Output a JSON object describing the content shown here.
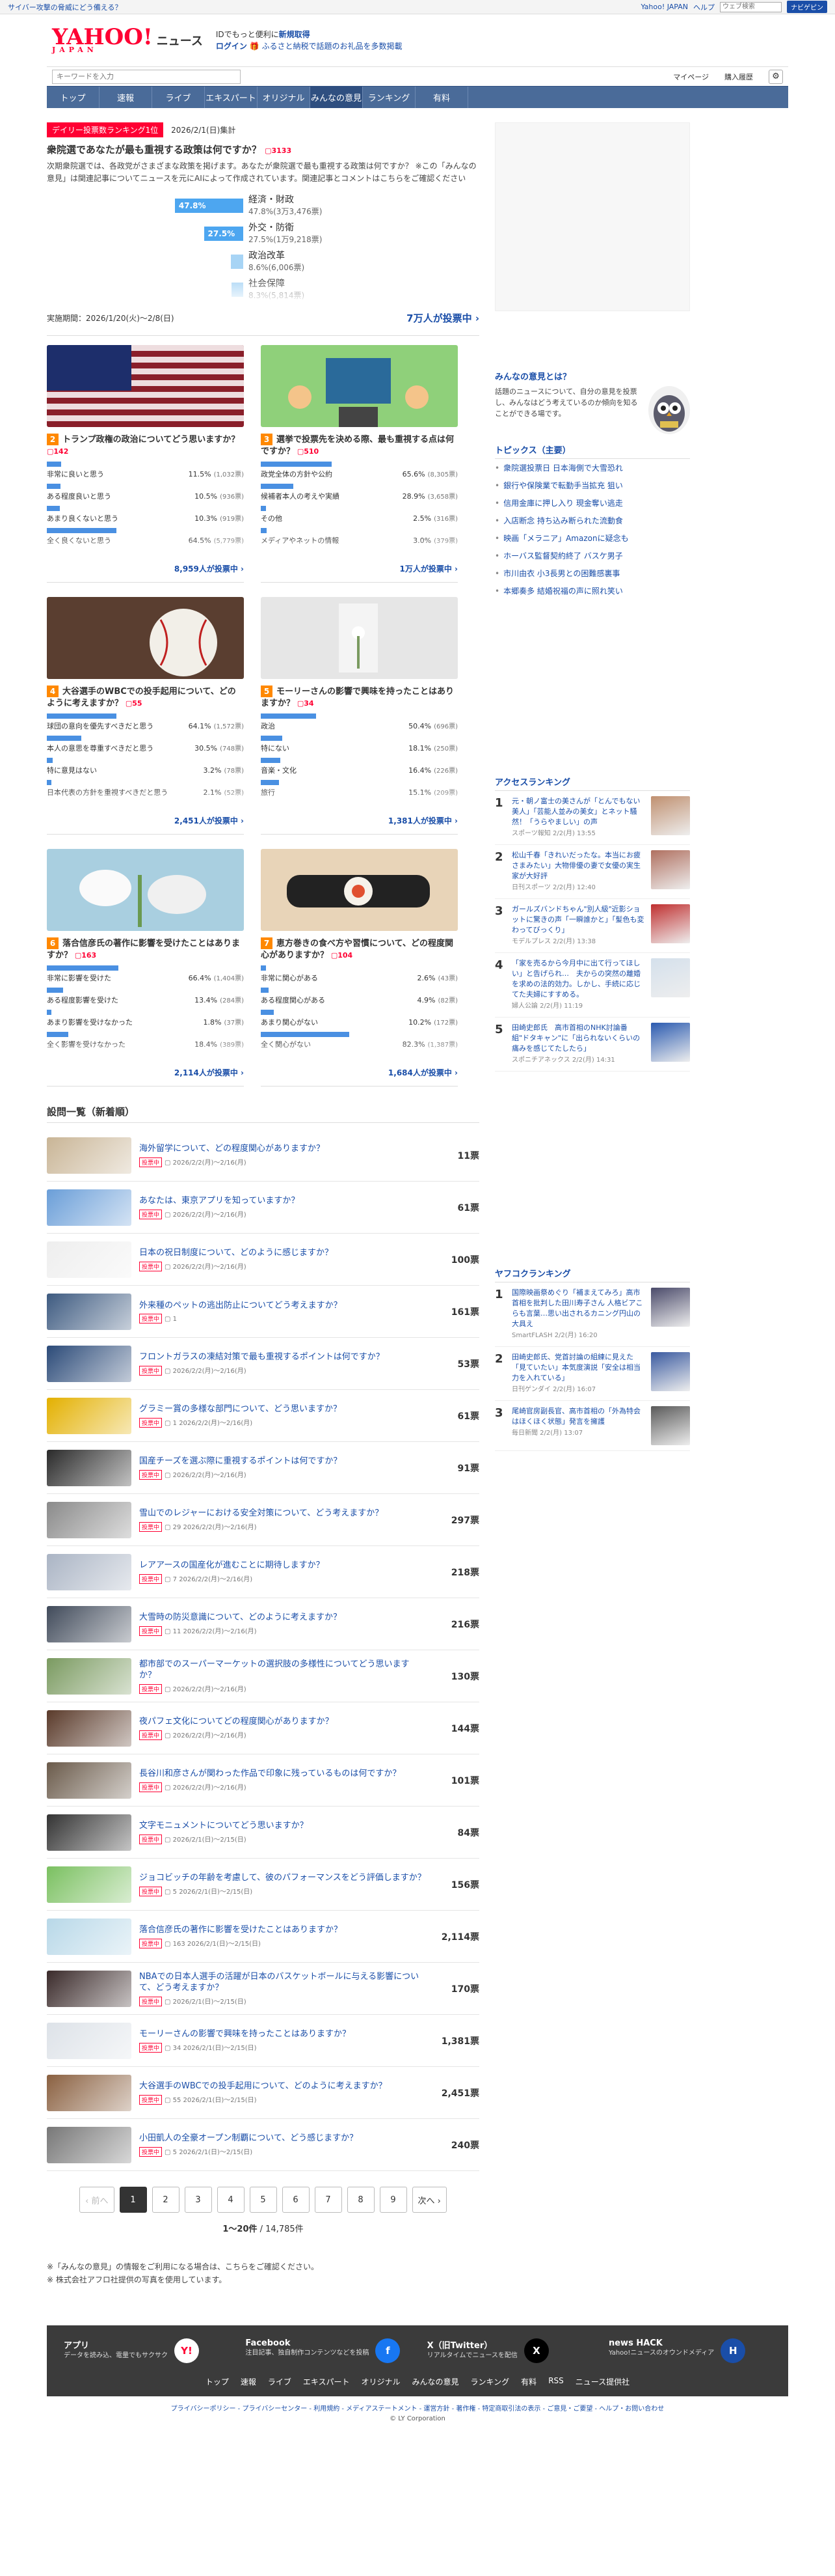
{
  "topbar": {
    "warning": "サイバー攻撃の脅威にどう備える？",
    "yahoo_japan": "Yahoo! JAPAN",
    "help": "ヘルプ",
    "search_placeholder": "ウェブ検索",
    "search_button": "ナビゲピン"
  },
  "header": {
    "logo_main": "YAHOO!",
    "logo_sub": "JAPAN",
    "logo_news": "ニュース",
    "promo1": "IDでもっと便利に",
    "promo1b": "新規取得",
    "promo2": "ログイン",
    "promo3": "ふるさと納税で話題のお礼品を多数掲載"
  },
  "subheader": {
    "keyword_placeholder": "キーワードを入力",
    "mypage": "マイページ",
    "history": "購入履歴"
  },
  "nav": [
    "トップ",
    "速報",
    "ライブ",
    "エキスパート",
    "オリジナル",
    "みんなの意見",
    "ランキング",
    "有料"
  ],
  "featured": {
    "rank_label": "デイリー投票数ランキング1位",
    "date": "2026/2/1(日)集計",
    "question": "衆院選であなたが最も重視する政策は何ですか？",
    "count": "3133",
    "description": "次期衆院選では、各政党がさまざまな政策を掲げます。あなたが衆院選で最も重視する政策は何ですか？ ※この「みんなの意見」は関連記事についてニュースを元にAIによって作成されています。関連記事とコメントはこちらをご確認ください",
    "options": [
      {
        "label": "経済・財政",
        "pct": "47.8%",
        "votes": "(3万3,476票)",
        "share": 47.8,
        "bar": "47.8%"
      },
      {
        "label": "外交・防衛",
        "pct": "27.5%",
        "votes": "(1万9,218票)",
        "share": 27.5,
        "bar": "27.5%"
      },
      {
        "label": "政治改革",
        "pct": "8.6%",
        "votes": "(6,006票)",
        "share": 8.6,
        "bar": ""
      },
      {
        "label": "社会保障",
        "pct": "8.3%",
        "votes": "(5,814票)",
        "share": 8.3,
        "bar": ""
      }
    ],
    "period": "実施期間：2026/1/20(火)〜2/8(日)",
    "total": "7万人が投票中 ›"
  },
  "cards": [
    {
      "num": "2",
      "title": "トランプ政権の政治についてどう思いますか？",
      "count": "142",
      "thumb": "flag",
      "total": "8,959人が投票中 ›",
      "options": [
        {
          "label": "非常に良いと思う",
          "pct": "11.5%",
          "votes": "(1,032票)",
          "share": 11.5
        },
        {
          "label": "ある程度良いと思う",
          "pct": "10.5%",
          "votes": "(936票)",
          "share": 10.5
        },
        {
          "label": "あまり良くないと思う",
          "pct": "10.3%",
          "votes": "(919票)",
          "share": 10.3
        },
        {
          "label": "全く良くないと思う",
          "pct": "64.5%",
          "votes": "(5,779票)",
          "share": 64.5
        }
      ]
    },
    {
      "num": "3",
      "title": "選挙で投票先を決める際、最も重視する点は何ですか？",
      "count": "510",
      "thumb": "people",
      "total": "1万人が投票中 ›",
      "options": [
        {
          "label": "政党全体の方針や公約",
          "pct": "65.6%",
          "votes": "(8,305票)",
          "share": 65.6
        },
        {
          "label": "候補者本人の考えや実績",
          "pct": "28.9%",
          "votes": "(3,658票)",
          "share": 28.9
        },
        {
          "label": "その他",
          "pct": "2.5%",
          "votes": "(316票)",
          "share": 2.5
        },
        {
          "label": "メディアやネットの情報",
          "pct": "3.0%",
          "votes": "(379票)",
          "share": 3.0
        }
      ]
    },
    {
      "num": "4",
      "title": "大谷選手のWBCでの投手起用について、どのように考えますか？",
      "count": "55",
      "thumb": "ball",
      "total": "2,451人が投票中 ›",
      "options": [
        {
          "label": "球団の意向を優先すべきだと思う",
          "pct": "64.1%",
          "votes": "(1,572票)",
          "share": 64.1
        },
        {
          "label": "本人の意思を尊重すべきだと思う",
          "pct": "30.5%",
          "votes": "(748票)",
          "share": 30.5
        },
        {
          "label": "特に意見はない",
          "pct": "3.2%",
          "votes": "(78票)",
          "share": 3.2
        },
        {
          "label": "日本代表の方針を重視すべきだと思う",
          "pct": "2.1%",
          "votes": "(52票)",
          "share": 2.1
        }
      ]
    },
    {
      "num": "5",
      "title": "モーリーさんの影響で興味を持ったことはありますか？",
      "count": "34",
      "thumb": "flower",
      "total": "1,381人が投票中 ›",
      "options": [
        {
          "label": "政治",
          "pct": "50.4%",
          "votes": "(696票)",
          "share": 50.4
        },
        {
          "label": "特にない",
          "pct": "18.1%",
          "votes": "(250票)",
          "share": 18.1
        },
        {
          "label": "音楽・文化",
          "pct": "16.4%",
          "votes": "(226票)",
          "share": 16.4
        },
        {
          "label": "旅行",
          "pct": "15.1%",
          "votes": "(209票)",
          "share": 15.1
        }
      ]
    },
    {
      "num": "6",
      "title": "落合信彦氏の著作に影響を受けたことはありますか？",
      "count": "163",
      "thumb": "lily",
      "total": "2,114人が投票中 ›",
      "options": [
        {
          "label": "非常に影響を受けた",
          "pct": "66.4%",
          "votes": "(1,404票)",
          "share": 66.4
        },
        {
          "label": "ある程度影響を受けた",
          "pct": "13.4%",
          "votes": "(284票)",
          "share": 13.4
        },
        {
          "label": "あまり影響を受けなかった",
          "pct": "1.8%",
          "votes": "(37票)",
          "share": 1.8
        },
        {
          "label": "全く影響を受けなかった",
          "pct": "18.4%",
          "votes": "(389票)",
          "share": 18.4
        }
      ]
    },
    {
      "num": "7",
      "title": "恵方巻きの食べ方や習慣について、どの程度関心がありますか？",
      "count": "104",
      "thumb": "sushi",
      "total": "1,684人が投票中 ›",
      "options": [
        {
          "label": "非常に関心がある",
          "pct": "2.6%",
          "votes": "(43票)",
          "share": 2.6
        },
        {
          "label": "ある程度関心がある",
          "pct": "4.9%",
          "votes": "(82票)",
          "share": 4.9
        },
        {
          "label": "あまり関心がない",
          "pct": "10.2%",
          "votes": "(172票)",
          "share": 10.2
        },
        {
          "label": "全く関心がない",
          "pct": "82.3%",
          "votes": "(1,387票)",
          "share": 82.3
        }
      ]
    }
  ],
  "list": {
    "title": "設問一覧（新着順）",
    "badge": "投票中",
    "items": [
      {
        "title": "海外留学について、どの程度関心がありますか？",
        "meta": "2026/2/2(月)〜2/16(月)",
        "count": "",
        "votes": "11票",
        "c": "#c9b596"
      },
      {
        "title": "あなたは、東京アプリを知っていますか？",
        "meta": "2026/2/2(月)〜2/16(月)",
        "count": "",
        "votes": "61票",
        "c": "#6a9ed8"
      },
      {
        "title": "日本の祝日制度について、どのように感じますか？",
        "meta": "2026/2/2(月)〜2/16(月)",
        "count": "",
        "votes": "100票",
        "c": "#eeeeee"
      },
      {
        "title": "外来種のペットの逃出防止についてどう考えますか？",
        "meta": "1",
        "count": "",
        "votes": "161票",
        "c": "#3d5a80"
      },
      {
        "title": "フロントガラスの凍結対策で最も重視するポイントは何ですか？",
        "meta": "2026/2/2(月)〜2/16(月)",
        "count": "",
        "votes": "53票",
        "c": "#2b4a78"
      },
      {
        "title": "グラミー賞の多様な部門について、どう思いますか？",
        "meta": "1 2026/2/2(月)〜2/16(月)",
        "count": "",
        "votes": "61票",
        "c": "#e3b000"
      },
      {
        "title": "国産チーズを選ぶ際に重視するポイントは何ですか？",
        "meta": "2026/2/2(月)〜2/16(月)",
        "count": "",
        "votes": "91票",
        "c": "#2a2a2a"
      },
      {
        "title": "雪山でのレジャーにおける安全対策について、どう考えますか？",
        "meta": "29 2026/2/2(月)〜2/16(月)",
        "count": "",
        "votes": "297票",
        "c": "#8a8a8a"
      },
      {
        "title": "レアアースの国産化が進むことに期待しますか？",
        "meta": "7 2026/2/2(月)〜2/16(月)",
        "count": "",
        "votes": "218票",
        "c": "#aab4c4"
      },
      {
        "title": "大雪時の防災意識について、どのように考えますか？",
        "meta": "11 2026/2/2(月)〜2/16(月)",
        "count": "",
        "votes": "216票",
        "c": "#404a5a"
      },
      {
        "title": "都市部でのスーパーマーケットの選択肢の多様性についてどう思いますか？",
        "meta": "2026/2/2(月)〜2/16(月)",
        "count": "",
        "votes": "130票",
        "c": "#7a9a60"
      },
      {
        "title": "夜パフェ文化についてどの程度関心がありますか？",
        "meta": "2026/2/2(月)〜2/16(月)",
        "count": "",
        "votes": "144票",
        "c": "#5a3a2a"
      },
      {
        "title": "長谷川和彦さんが関わった作品で印象に残っているものは何ですか？",
        "meta": "2026/2/2(月)〜2/16(月)",
        "count": "",
        "votes": "101票",
        "c": "#6a5a4a"
      },
      {
        "title": "文字モニュメントについてどう思いますか？",
        "meta": "2026/2/1(日)〜2/15(日)",
        "count": "",
        "votes": "84票",
        "c": "#333333"
      },
      {
        "title": "ジョコビッチの年齢を考慮して、彼のパフォーマンスをどう評価しますか？",
        "meta": "5 2026/2/1(日)〜2/15(日)",
        "count": "",
        "votes": "156票",
        "c": "#7ac060"
      },
      {
        "title": "落合信彦氏の著作に影響を受けたことはありますか？",
        "meta": "163 2026/2/1(日)〜2/15(日)",
        "count": "",
        "votes": "2,114票",
        "c": "#b8d8e8"
      },
      {
        "title": "NBAでの日本人選手の活躍が日本のバスケットボールに与える影響について、どう考えますか？",
        "meta": "2026/2/1(日)〜2/15(日)",
        "count": "",
        "votes": "170票",
        "c": "#3a2a2a"
      },
      {
        "title": "モーリーさんの影響で興味を持ったことはありますか？",
        "meta": "34 2026/2/1(日)〜2/15(日)",
        "count": "",
        "votes": "1,381票",
        "c": "#dde2e8"
      },
      {
        "title": "大谷選手のWBCでの投手起用について、どのように考えますか？",
        "meta": "55 2026/2/1(日)〜2/15(日)",
        "count": "",
        "votes": "2,451票",
        "c": "#8a6040"
      },
      {
        "title": "小田凱人の全豪オープン制覇について、どう感じますか？",
        "meta": "5 2026/2/1(日)〜2/15(日)",
        "count": "",
        "votes": "240票",
        "c": "#777777"
      }
    ]
  },
  "pager": {
    "prev": "‹ 前へ",
    "pages": [
      "1",
      "2",
      "3",
      "4",
      "5",
      "6",
      "7",
      "8",
      "9"
    ],
    "next": "次へ ›",
    "range_a": "1〜20件",
    "range_b": " / 14,785件"
  },
  "notes": [
    "※「みんなの意見」の情報をご利用になる場合は、こちらをご確認ください。",
    "※ 株式会社アフロ社提供の写真を使用しています。"
  ],
  "side": {
    "opinion_title": "みんなの意見とは？",
    "opinion_text": "話題のニュースについて、自分の意見を投票し、みんなはどう考えているのか傾向を知ることができる場です。",
    "topics_title": "トピックス（主要）",
    "topics": [
      "衆院選投票日 日本海側で大雪恐れ",
      "銀行や保険業で転勤手当拡充 狙い",
      "信用金庫に押し入り 現金奪い逃走",
      "入店断念 持ち込み断られた流動食",
      "映画「メラニア」Amazonに疑念も",
      "ホーバス監督契約終了 バスケ男子",
      "市川由衣 小3長男との困難感裏事",
      "本郷奏多 結婚祝福の声に照れ笑い"
    ],
    "access_title": "アクセスランキング",
    "access": [
      {
        "n": "1",
        "t": "元・朝ノ富士の美さんが「とんでもない美人」「芸能人並みの美女」とネット騒然！「うらやましい」の声",
        "s": "スポーツ報知 2/2(月) 13:55",
        "c": "#c09070"
      },
      {
        "n": "2",
        "t": "松山千春「きれいだったな。本当にお疲さまみたい」大物俳優の妻で女優の実生家が大好評",
        "s": "日刊スポーツ 2/2(月) 12:40",
        "c": "#b07060"
      },
      {
        "n": "3",
        "t": "ガールズバンドちゃん\"別人級\"近影ショットに驚きの声「一瞬誰かと」「髪色も変わってびっくり」",
        "s": "モデルプレス 2/2(月) 13:38",
        "c": "#c03030"
      },
      {
        "n": "4",
        "t": "「家を売るから今月中に出て行ってほしい」と告げられ…　夫からの突然の離婚を求めの法的効力。しかし、手続に応じてた夫婦にすすめる。",
        "s": "婦人公論 2/2(月) 11:19",
        "c": "#d4e0ec"
      },
      {
        "n": "5",
        "t": "田崎史郎氏　高市首相のNHK討論番組\"ドタキャン\"に「出られないくらいの痛みを感じてたしたら」",
        "s": "スポニチアネックス 2/2(月) 14:31",
        "c": "#2a5ab0"
      }
    ],
    "yahuko_title": "ヤフコクランキング",
    "yahuko": [
      {
        "n": "1",
        "t": "国際映画祭めぐり「補まえてみろ」高市首相を批判した田川寿子さん 人格ビアこらも言葉…思い出されるカニング円山の大具え",
        "s": "SmartFLASH 2/2(月) 16:20",
        "c": "#4a4a6a"
      },
      {
        "n": "2",
        "t": "田崎史郎氏、党首討論の組練に見えた「見ていたい」本気度演説「安全は相当力を入れている」",
        "s": "日刊ゲンダイ 2/2(月) 16:07",
        "c": "#3a5aa0"
      },
      {
        "n": "3",
        "t": "尾崎官房副長官、高市首相の「外為特会はほくほく状態」発言を擁護",
        "s": "毎日新聞 2/2(月) 13:07",
        "c": "#5a5a5a"
      }
    ]
  },
  "footer": {
    "cols": [
      {
        "t": "アプリ",
        "d": "データを読み込、電量でもサクサク",
        "ic": "Y!",
        "c": "#ffffff",
        "fc": "#ff0033"
      },
      {
        "t": "Facebook",
        "d": "注目記事、独自制作コンテンツなどを投稿",
        "ic": "f",
        "c": "#1877f2",
        "fc": "#ffffff"
      },
      {
        "t": "X（旧Twitter）",
        "d": "リアルタイムでニュースを配信",
        "ic": "X",
        "c": "#000000",
        "fc": "#ffffff"
      },
      {
        "t": "news HACK",
        "d": "Yahoo!ニュースのオウンドメディア",
        "ic": "H",
        "c": "#1a4ea8",
        "fc": "#ffffff"
      }
    ],
    "links": [
      "トップ",
      "速報",
      "ライブ",
      "エキスパート",
      "オリジナル",
      "みんなの意見",
      "ランキング",
      "有料",
      "RSS",
      "ニュース提供社"
    ],
    "bottom": "プライバシーポリシー - プライバシーセンター - 利用規約 - メディアステートメント - 運営方針 - 著作権 - 特定商取引法の表示 - ご意見・ご要望 - ヘルプ・お問い合わせ",
    "copyright": "© LY Corporation"
  }
}
